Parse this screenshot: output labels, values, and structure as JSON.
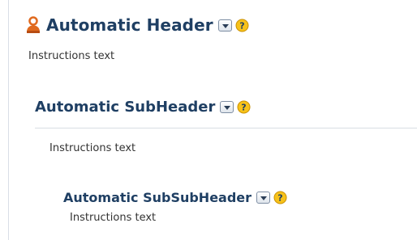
{
  "header": {
    "title": "Automatic Header",
    "instructions": "Instructions text",
    "icons": [
      "person-icon",
      "dropdown-arrow-icon",
      "help-icon"
    ]
  },
  "subheader": {
    "title": "Automatic SubHeader",
    "instructions": "Instructions text",
    "icons": [
      "dropdown-arrow-icon",
      "help-icon"
    ]
  },
  "subsubheader": {
    "title": "Automatic SubSubHeader",
    "instructions": "Instructions text",
    "icons": [
      "dropdown-arrow-icon",
      "help-icon"
    ]
  },
  "colors": {
    "title": "#1f3f63",
    "person_icon": "#e06a1f",
    "help_icon": "#f2b400"
  }
}
